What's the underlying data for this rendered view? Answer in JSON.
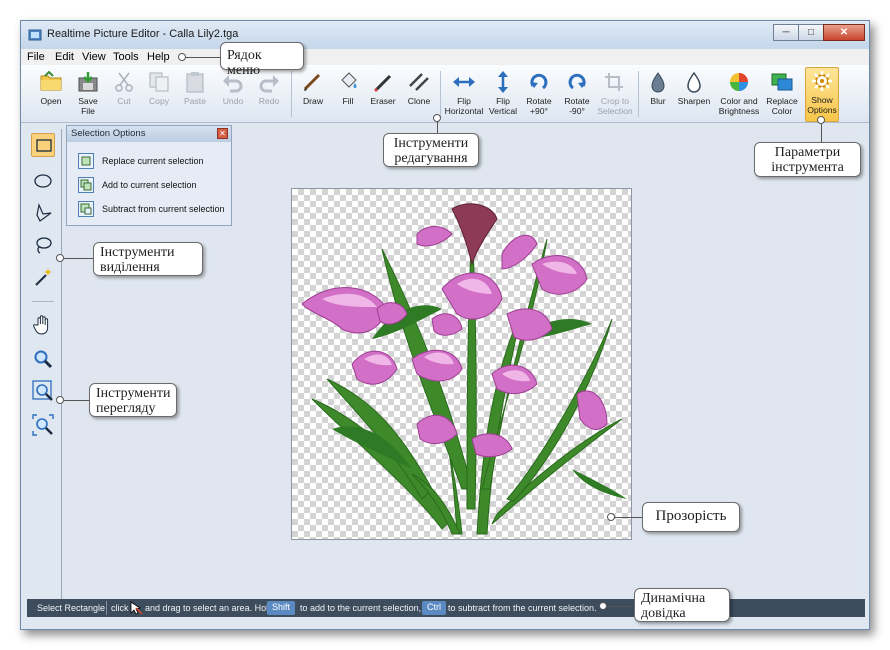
{
  "window": {
    "title": "Realtime Picture Editor - Calla Lily2.tga",
    "controls": [
      "minimize",
      "maximize",
      "close"
    ]
  },
  "menu": [
    "File",
    "Edit",
    "View",
    "Tools",
    "Help"
  ],
  "toolbar": {
    "open": "Open",
    "save_l1": "Save",
    "save_l2": "File",
    "cut": "Cut",
    "copy": "Copy",
    "paste": "Paste",
    "undo": "Undo",
    "redo": "Redo",
    "draw": "Draw",
    "fill": "Fill",
    "eraser": "Eraser",
    "clone": "Clone",
    "fliph_l1": "Flip",
    "fliph_l2": "Horizontal",
    "flipv_l1": "Flip",
    "flipv_l2": "Vertical",
    "rotp_l1": "Rotate",
    "rotp_l2": "+90°",
    "rotm_l1": "Rotate",
    "rotm_l2": "-90°",
    "crop_l1": "Crop to",
    "crop_l2": "Selection",
    "blur": "Blur",
    "sharpen": "Sharpen",
    "cb_l1": "Color and",
    "cb_l2": "Brightness",
    "rc_l1": "Replace",
    "rc_l2": "Color",
    "so_l1": "Show",
    "so_l2": "Options"
  },
  "selection_panel": {
    "title": "Selection Options",
    "replace": "Replace current selection",
    "add": "Add to current selection",
    "subtract": "Subtract from current selection"
  },
  "status": {
    "mode": "Select Rectangle",
    "click": "click",
    "drag": "and drag to select an area. Hold",
    "shift": "Shift",
    "add": "to add to the current selection, or",
    "ctrl": "Ctrl",
    "subtract": "to subtract from the current selection."
  },
  "callouts": {
    "menu_bar": "Рядок меню",
    "edit_tools": "Інструменти редагування",
    "tool_options": "Параметри інструмента",
    "selection_tools": "Інструменти виділення",
    "view_tools": "Інструменти перегляду",
    "transparency": "Прозорість",
    "dynamic_help": "Динамічна довідка"
  },
  "colors": {
    "accent_active": "#f8c548",
    "status_bar": "#3d4d5e",
    "key_badge": "#5b8ac2"
  }
}
